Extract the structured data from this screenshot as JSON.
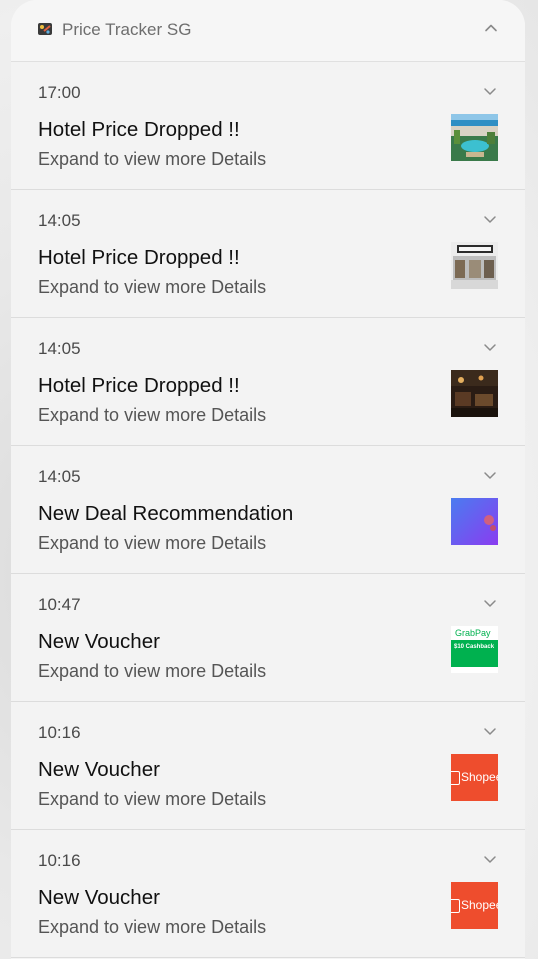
{
  "app": {
    "name": "Price Tracker SG"
  },
  "notifications": [
    {
      "time": "17:00",
      "title": "Hotel Price Dropped !!",
      "body": "Expand to view more Details",
      "thumbnail": "hotel-pool-photo"
    },
    {
      "time": "14:05",
      "title": "Hotel Price Dropped !!",
      "body": "Expand to view more Details",
      "thumbnail": "hotel-entrance-photo"
    },
    {
      "time": "14:05",
      "title": "Hotel Price Dropped !!",
      "body": "Expand to view more Details",
      "thumbnail": "hotel-interior-photo"
    },
    {
      "time": "14:05",
      "title": "New Deal Recommendation",
      "body": "Expand to view more Details",
      "thumbnail": "deal-gradient-image"
    },
    {
      "time": "10:47",
      "title": "New Voucher",
      "body": "Expand to view more Details",
      "thumbnail": "grabpay-voucher"
    },
    {
      "time": "10:16",
      "title": "New Voucher",
      "body": "Expand to view more Details",
      "thumbnail": "shopee-logo"
    },
    {
      "time": "10:16",
      "title": "New Voucher",
      "body": "Expand to view more Details",
      "thumbnail": "shopee-logo"
    }
  ],
  "thumbnails": {
    "grabpay": {
      "brand": "GrabPay",
      "headline": "$10 Cashback",
      "color": "#00b14f"
    },
    "shopee": {
      "brand": "Shopee",
      "color": "#ee4d2d"
    }
  },
  "icons": {
    "collapse": "chevron-up-icon",
    "expand": "chevron-down-icon",
    "app": "price-tag-icon"
  }
}
